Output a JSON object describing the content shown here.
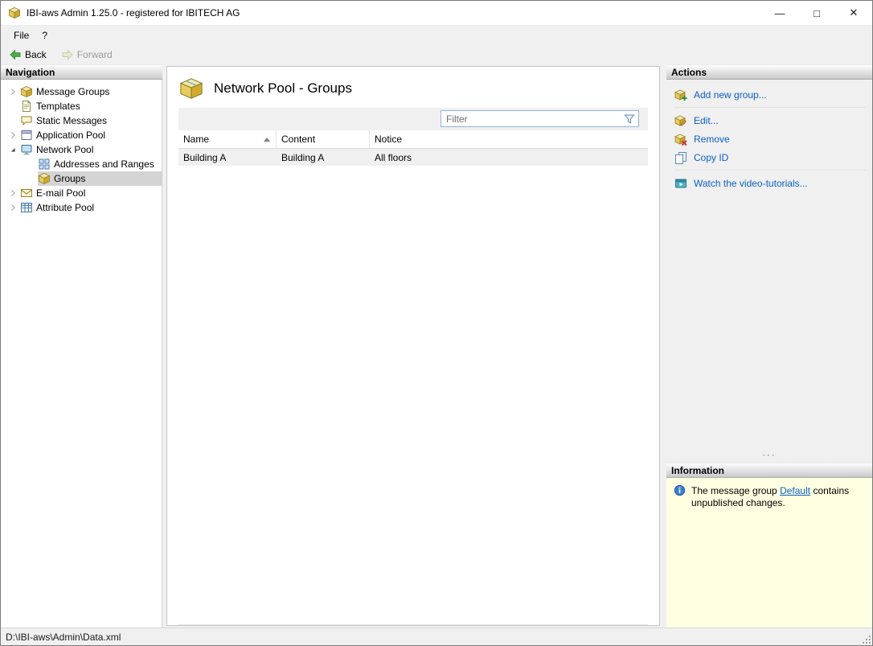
{
  "window": {
    "title": "IBI-aws Admin 1.25.0 - registered for IBITECH AG",
    "controls": {
      "minimize": "—",
      "maximize": "□",
      "close": "✕"
    }
  },
  "menu": {
    "items": [
      {
        "label": "File"
      },
      {
        "label": "?"
      }
    ]
  },
  "toolbar": {
    "back_label": "Back",
    "forward_label": "Forward"
  },
  "navigation": {
    "header": "Navigation",
    "items": [
      {
        "label": "Message Groups",
        "state": "collapsed"
      },
      {
        "label": "Templates"
      },
      {
        "label": "Static Messages"
      },
      {
        "label": "Application Pool",
        "state": "collapsed"
      },
      {
        "label": "Network Pool",
        "state": "expanded"
      },
      {
        "label": "Addresses and Ranges",
        "child_of": "Network Pool"
      },
      {
        "label": "Groups",
        "child_of": "Network Pool",
        "selected": true
      },
      {
        "label": "E-mail Pool",
        "state": "collapsed"
      },
      {
        "label": "Attribute Pool",
        "state": "collapsed"
      }
    ]
  },
  "main": {
    "title": "Network Pool - Groups",
    "filter": {
      "placeholder": "Filter"
    },
    "table": {
      "columns": [
        "Name",
        "Content",
        "Notice"
      ],
      "sort": {
        "column": "Name",
        "direction": "ascending"
      },
      "rows": [
        [
          "Building A",
          "Building A",
          "All floors"
        ]
      ]
    }
  },
  "actions": {
    "header": "Actions",
    "items": [
      {
        "label": "Add new group..."
      },
      {
        "label": "Edit..."
      },
      {
        "label": "Remove"
      },
      {
        "label": "Copy ID"
      },
      {
        "label": "Watch the video-tutorials..."
      }
    ],
    "splitter_glyph": "···"
  },
  "information": {
    "header": "Information",
    "text_before": "The message group",
    "link_label": "Default",
    "text_after": "contains unpublished changes."
  },
  "statusbar": {
    "path": "D:\\IBI-aws\\Admin\\Data.xml"
  },
  "colors": {
    "link_blue": "#0B5FC4",
    "info_panel_bg": "#FFFFE1",
    "selected_item_bg": "#D4D4D4",
    "back_arrow_green": "#4CAF3F",
    "panel_header_gradient_top": "#FDFDFD",
    "panel_header_gradient_bottom": "#C9C9C9"
  }
}
